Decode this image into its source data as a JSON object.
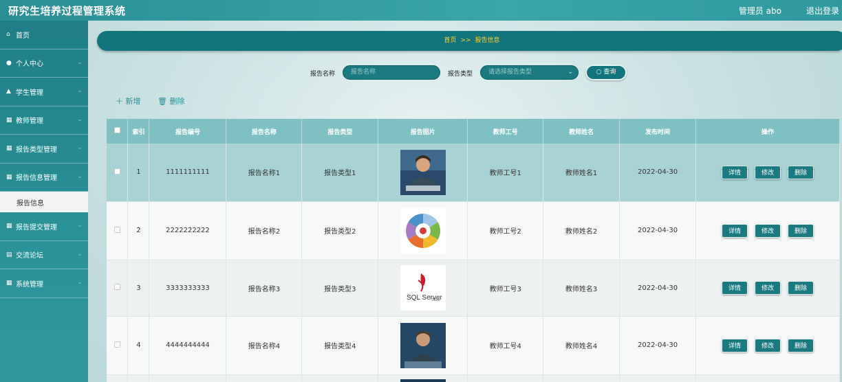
{
  "app": {
    "title": "研究生培养过程管理系统",
    "user": "管理员 abo",
    "logout": "退出登录"
  },
  "sidebar": {
    "items": [
      {
        "label": "首页",
        "icon": "home-icon",
        "glyph": "⌂"
      },
      {
        "label": "个人中心",
        "icon": "user-icon",
        "glyph": "●"
      },
      {
        "label": "学生管理",
        "icon": "student-icon",
        "glyph": "▲"
      },
      {
        "label": "教师管理",
        "icon": "grid-icon",
        "glyph": "▦"
      },
      {
        "label": "报告类型管理",
        "icon": "grid-icon",
        "glyph": "▦"
      },
      {
        "label": "报告信息管理",
        "icon": "grid-icon",
        "glyph": "▦"
      },
      {
        "label": "报告提交管理",
        "icon": "grid-icon",
        "glyph": "▦"
      },
      {
        "label": "交流论坛",
        "icon": "forum-icon",
        "glyph": "▤"
      },
      {
        "label": "系统管理",
        "icon": "grid-icon",
        "glyph": "▦"
      }
    ],
    "active_sub": "报告信息"
  },
  "breadcrumb": {
    "home": "首页",
    "sep": ">>",
    "current": "报告信息"
  },
  "search": {
    "name_label": "报告名称",
    "name_placeholder": "报告名称",
    "type_label": "报告类型",
    "type_placeholder": "请选择报告类型",
    "query_label": "查询"
  },
  "actions": {
    "add": "新增",
    "delete": "删除"
  },
  "table": {
    "headers": [
      "索引",
      "报告编号",
      "报告名称",
      "报告类型",
      "报告图片",
      "教师工号",
      "教师姓名",
      "发布时间",
      "操作"
    ],
    "rows": [
      {
        "index": "1",
        "code": "1111111111",
        "name": "报告名称1",
        "type": "报告类型1",
        "image": "person-at-laptop",
        "teacher_no": "教师工号1",
        "teacher_name": "教师姓名1",
        "date": "2022-04-30"
      },
      {
        "index": "2",
        "code": "2222222222",
        "name": "报告名称2",
        "type": "报告类型2",
        "image": "circular-diagram",
        "teacher_no": "教师工号2",
        "teacher_name": "教师姓名2",
        "date": "2022-04-30"
      },
      {
        "index": "3",
        "code": "3333333333",
        "name": "报告名称3",
        "type": "报告类型3",
        "image": "sql-server-logo",
        "teacher_no": "教师工号3",
        "teacher_name": "教师姓名3",
        "date": "2022-04-30"
      },
      {
        "index": "4",
        "code": "4444444444",
        "name": "报告名称4",
        "type": "报告类型4",
        "image": "man-at-computer",
        "teacher_no": "教师工号4",
        "teacher_name": "教师姓名4",
        "date": "2022-04-30"
      }
    ],
    "row_buttons": {
      "detail": "详情",
      "edit": "修改",
      "delete": "删除"
    }
  },
  "images": {
    "sql_logo_text": "SQL Server",
    "sql_logo_version": "2012"
  },
  "colors": {
    "primary": "#1b7a80",
    "header": "#2a8f96",
    "breadcrumb_text": "#f5d34a",
    "table_header": "#7fc0c3"
  }
}
